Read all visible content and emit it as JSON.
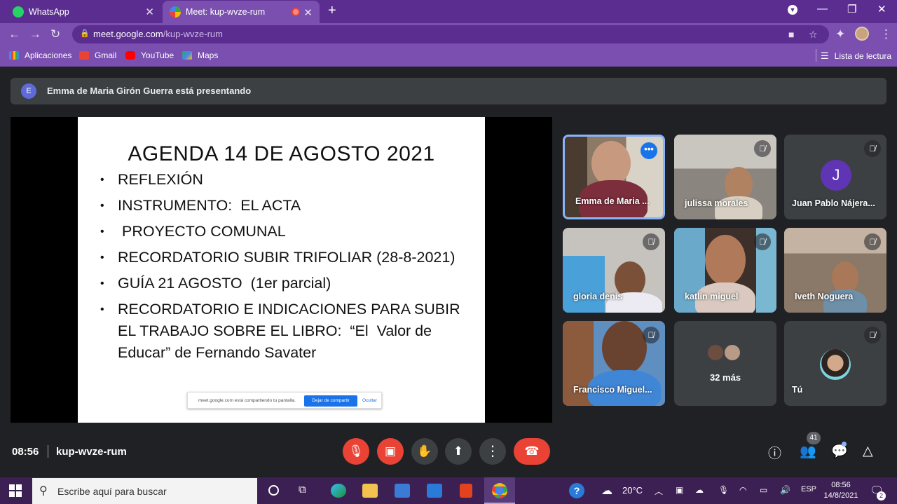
{
  "browser": {
    "tabs": [
      {
        "label": "WhatsApp",
        "active": false
      },
      {
        "label": "Meet: kup-wvze-rum",
        "active": true
      }
    ],
    "url_host": "meet.google.com",
    "url_path": "/kup-wvze-rum",
    "bookmarks": [
      {
        "label": "Aplicaciones",
        "icon": "apps-grid-icon"
      },
      {
        "label": "Gmail",
        "icon": "gmail-icon"
      },
      {
        "label": "YouTube",
        "icon": "youtube-icon"
      },
      {
        "label": "Maps",
        "icon": "maps-icon"
      }
    ],
    "reading_list": "Lista de lectura"
  },
  "meet": {
    "presenting_initial": "E",
    "presenting_text": "Emma de Maria Girón Guerra está presentando",
    "slide": {
      "title": "AGENDA 14 DE AGOSTO 2021",
      "bullets": [
        "REFLEXIÓN",
        "INSTRUMENTO:  EL ACTA",
        " PROYECTO COMUNAL",
        "RECORDATORIO SUBIR TRIFOLIAR (28-8-2021)",
        "GUÍA 21 AGOSTO  (1er parcial)",
        "RECORDATORIO E INDICACIONES PARA SUBIR EL TRABAJO SOBRE EL LIBRO:  “El  Valor de Educar” de Fernando Savater"
      ],
      "share_message": "meet.google.com está compartiendo tu pantalla.",
      "share_stop": "Dejar de compartir",
      "share_hide": "Ocultar"
    },
    "participants": [
      {
        "name": "Emma de Maria ...",
        "muted": false
      },
      {
        "name": "julissa morales",
        "muted": true
      },
      {
        "name": "Juan Pablo Nájera...",
        "muted": true,
        "initial": "J"
      },
      {
        "name": "gloria denis",
        "muted": true
      },
      {
        "name": "katlin miguel",
        "muted": true
      },
      {
        "name": "Iveth Noguera",
        "muted": true
      },
      {
        "name": "Francisco Miguel...",
        "muted": true
      },
      {
        "name": "32 más",
        "muted": false
      },
      {
        "name": "Tú",
        "muted": true
      }
    ],
    "time": "08:56",
    "meeting_code": "kup-wvze-rum",
    "people_count": "41"
  },
  "taskbar": {
    "search_placeholder": "Escribe aquí para buscar",
    "temperature": "20°C",
    "language": "ESP",
    "time": "08:56",
    "date": "14/8/2021",
    "notifications": "2"
  }
}
